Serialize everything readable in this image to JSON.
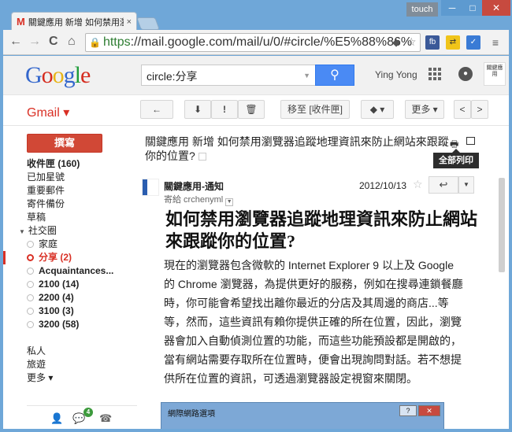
{
  "window": {
    "touch_label": "touch",
    "min": "─",
    "max": "□",
    "close": "✕"
  },
  "tab": {
    "title": "關鍵應用 新增 如何禁用瀏",
    "icon": "M",
    "close": "×"
  },
  "toolbar": {
    "back": "←",
    "forward": "→",
    "reload": "C",
    "home": "⌂",
    "url_https": "https",
    "url_rest": "://mail.google.com/mail/u/0/#circle/%E5%88%86%",
    "ext_fb": "fb"
  },
  "gmail_header": {
    "logo": [
      "G",
      "o",
      "o",
      "g",
      "l",
      "e"
    ],
    "search_value": "circle:分享",
    "username": "Ying Yong",
    "avatar_text": "關鍵應用"
  },
  "gmail_label": "Gmail ▾",
  "actions": {
    "back": "←",
    "archive": "⬇",
    "spam": "!",
    "delete": "🗑",
    "move_inbox": "移至 [收件匣]",
    "labels": "◆ ▾",
    "more": "更多 ▾",
    "prev": "<",
    "next": ">"
  },
  "sidebar": {
    "compose": "撰寫",
    "items": [
      {
        "label": "收件匣 (160)",
        "bold": true
      },
      {
        "label": "已加星號"
      },
      {
        "label": "重要郵件"
      },
      {
        "label": "寄件備份"
      },
      {
        "label": "草稿"
      },
      {
        "label": "社交圈",
        "tree": true
      },
      {
        "label": "家庭",
        "circle": true
      },
      {
        "label": "分享 (2)",
        "circle": true,
        "active": true
      },
      {
        "label": "Acquaintances...",
        "circle": true,
        "bold": true
      },
      {
        "label": "2100 (14)",
        "circle": true,
        "bold": true
      },
      {
        "label": "2200 (4)",
        "circle": true,
        "bold": true
      },
      {
        "label": "3100 (3)",
        "circle": true,
        "bold": true
      },
      {
        "label": "3200 (58)",
        "circle": true,
        "bold": true
      },
      {
        "label": ""
      },
      {
        "label": "私人"
      },
      {
        "label": "旅遊"
      },
      {
        "label": "更多 ▾"
      }
    ],
    "chat_badge": "4"
  },
  "message": {
    "subject": "關鍵應用 新增 如何禁用瀏覽器追蹤地理資訊來防止網站來跟蹤你的位置?",
    "tooltip": "全部列印",
    "sender": "關鍵應用-通知",
    "recipient": "寄給 crchenyml",
    "date": "2012/10/13",
    "article_title": "如何禁用瀏覽器追蹤地理資訊來防止網站來跟蹤你的位置?",
    "article_body": "現在的瀏覽器包含微軟的 Internet Explorer 9 以上及 Google 的 Chrome 瀏覽器，為提供更好的服務，例如在搜尋連鎖餐廳時，你可能會希望找出離你最近的分店及其周邊的商店...等等，然而，這些資訊有賴你提供正確的所在位置，因此，瀏覽器會加入自動偵測位置的功能，而這些功能預設都是開啟的，當有網站需要存取所在位置時，便會出現詢問對話。若不想提供所在位置的資訊，可透過瀏覽器設定視窗來關閉。",
    "dialog_title": "網際網路選項",
    "dialog_help": "?",
    "dialog_close": "✕"
  }
}
